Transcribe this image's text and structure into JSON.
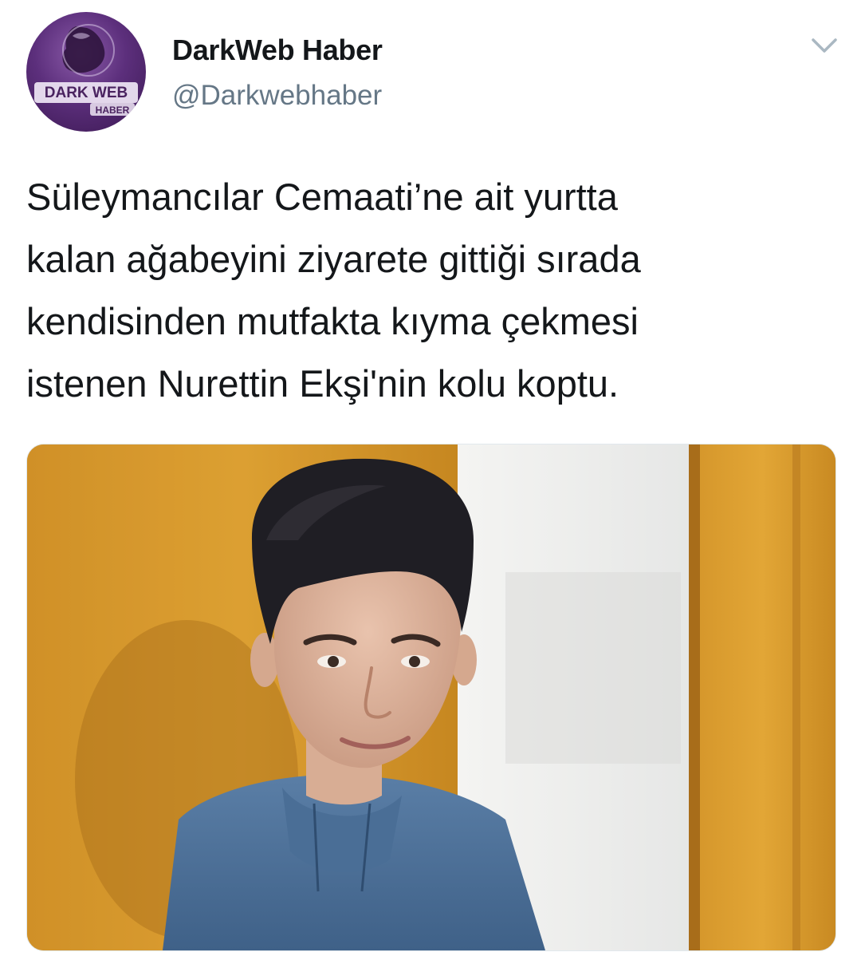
{
  "tweet": {
    "author": {
      "name": "DarkWeb Haber",
      "handle": "@Darkwebhaber",
      "avatar_logo_line1": "DARK WEB",
      "avatar_logo_line2": "HABER"
    },
    "text_lines": [
      "Süleymancılar Cemaati’ne ait yurtta",
      "kalan ağabeyini ziyarete gittiği sırada",
      "kendisinden mutfakta kıyma çekmesi",
      "istenen Nurettin Ekşi'nin kolu koptu."
    ],
    "icons": {
      "menu": "chevron-down-icon"
    },
    "colors": {
      "name": "#14171a",
      "handle": "#657786",
      "avatar_purple": "#5c2f7c",
      "caret": "#aab8c2"
    }
  }
}
